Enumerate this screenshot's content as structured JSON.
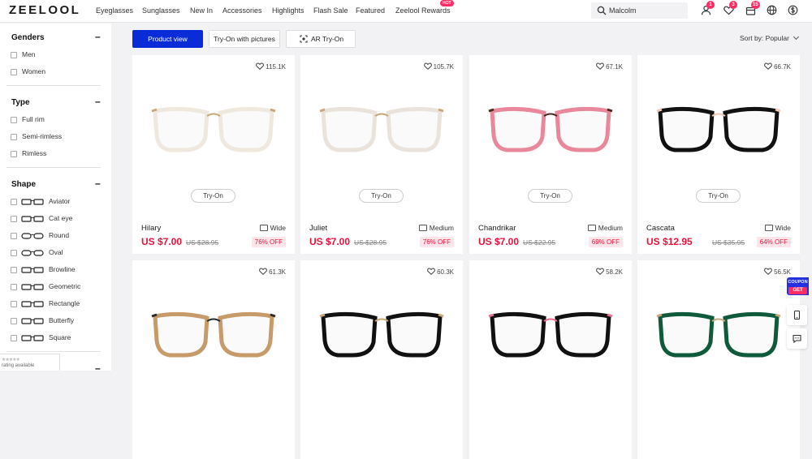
{
  "header": {
    "logo": "ZEELOOL",
    "nav": [
      "Eyeglasses",
      "Sunglasses",
      "New In",
      "Accessories",
      "Highlights",
      "Flash Sale",
      "Featured",
      "Zeelool Rewards"
    ],
    "hot_badge": "HOT",
    "search_value": "Malcolm",
    "badges": {
      "account": "1",
      "wishlist": "3",
      "cart": "15"
    }
  },
  "sidebar": {
    "groups": [
      {
        "title": "Genders",
        "options": [
          "Men",
          "Women"
        ]
      },
      {
        "title": "Type",
        "options": [
          "Full rim",
          "Semi-rimless",
          "Rimless"
        ]
      },
      {
        "title": "Shape",
        "options": [
          "Aviator",
          "Cat eye",
          "Round",
          "Oval",
          "Browline",
          "Geometric",
          "Rectangle",
          "Butterfly",
          "Square"
        ]
      }
    ],
    "collapse_symbol": "–",
    "rating_stars": "★★★★★",
    "rating_text": "rating available"
  },
  "toolbar": {
    "product_view": "Product view",
    "try_on_pictures": "Try-On with pictures",
    "ar_try_on": "AR Try-On",
    "sort": "Sort by: Popular"
  },
  "products": [
    {
      "likes": "115.1K",
      "name": "Hilary",
      "width": "Wide",
      "price": "US $7.00",
      "old_price": "US $28.95",
      "off": "76% OFF",
      "try_on": "Try-On",
      "frame": "#efe8df",
      "frame2": "#c9a77a"
    },
    {
      "likes": "105.7K",
      "name": "Juliet",
      "width": "Medium",
      "price": "US $7.00",
      "old_price": "US $28.95",
      "off": "76% OFF",
      "try_on": "Try-On",
      "frame": "#e9e3dc",
      "frame2": "#c9a77a"
    },
    {
      "likes": "67.1K",
      "name": "Chandrikar",
      "width": "Medium",
      "price": "US $7.00",
      "old_price": "US $22.95",
      "off": "69% OFF",
      "try_on": "Try-On",
      "frame": "#e9889b",
      "frame2": "#4a2a1f"
    },
    {
      "likes": "66.7K",
      "name": "Cascata",
      "width": "Wide",
      "price": "US $12.95",
      "old_price": "US $35.95",
      "off": "64% OFF",
      "try_on": "Try-On",
      "frame": "#111111",
      "frame2": "#f2c9b8"
    },
    {
      "likes": "61.3K",
      "frame": "#c79a6a",
      "frame2": "#2a2a2a"
    },
    {
      "likes": "60.3K",
      "frame": "#111111",
      "frame2": "#c9a77a"
    },
    {
      "likes": "58.2K",
      "frame": "#111111",
      "frame2": "#e9718d"
    },
    {
      "likes": "56.5K",
      "frame": "#0f5a3a",
      "frame2": "#c9a77a"
    }
  ],
  "floating": {
    "coupon": "COUPON",
    "get": "GET"
  },
  "colors": {
    "accent": "#0a2bd8",
    "price": "#e8123c",
    "badge": "#ff2d63"
  }
}
